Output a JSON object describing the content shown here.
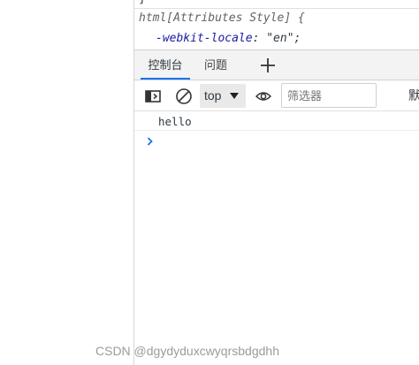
{
  "styles": {
    "previous_rule_end": "}",
    "selector": "html[Attributes Style] {",
    "declaration_property": "-webkit-locale",
    "declaration_separator": ": ",
    "declaration_value": "\"en\";"
  },
  "drawer_tabs": [
    {
      "label": "控制台",
      "active": true
    },
    {
      "label": "问题",
      "active": false
    }
  ],
  "toolbar": {
    "context_value": "top",
    "filter_placeholder": "筛选器",
    "levels_label_partial": "默"
  },
  "console": {
    "messages": [
      "hello"
    ]
  },
  "watermark": "CSDN @dgydyduxcwyqrsbdgdhh",
  "colors": {
    "accent": "#1a73e8",
    "prompt": "#1a73e8",
    "css_property": "#1a1aa6"
  },
  "icons": {
    "sidebar_toggle": "sidebar-toggle-icon",
    "clear": "clear-console-icon",
    "caret": "caret-down-icon",
    "eye": "live-expression-eye-icon",
    "add_tab": "plus-icon",
    "prompt": "chevron-right-icon"
  }
}
